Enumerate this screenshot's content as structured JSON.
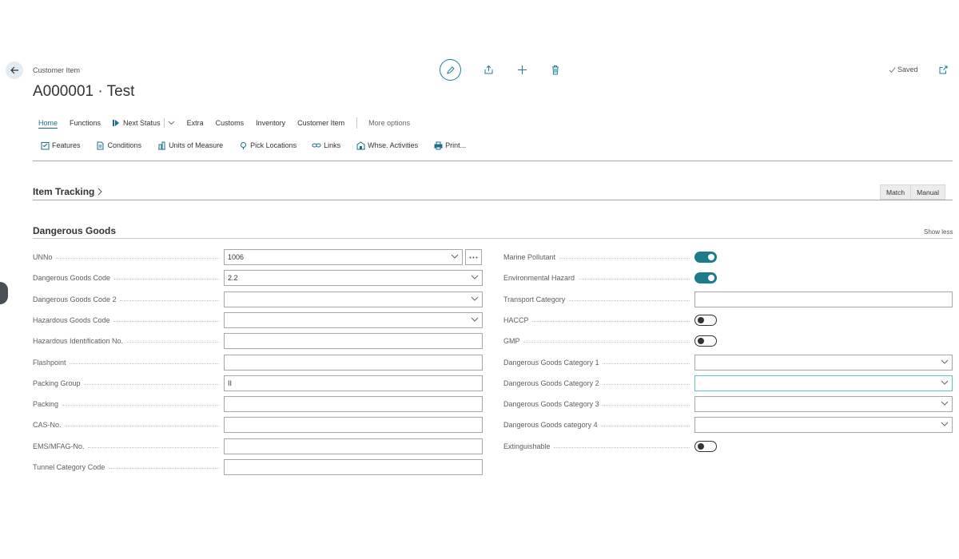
{
  "header": {
    "breadcrumb": "Customer Item",
    "title": "A000001 · Test",
    "saved_label": "Saved"
  },
  "tabs": [
    {
      "label": "Home",
      "active": true
    },
    {
      "label": "Functions"
    },
    {
      "label": "Next Status"
    },
    {
      "label": "Extra"
    },
    {
      "label": "Customs"
    },
    {
      "label": "Inventory"
    },
    {
      "label": "Customer Item"
    }
  ],
  "more_options": "More options",
  "promoted": [
    {
      "label": "Features",
      "icon": "features-icon"
    },
    {
      "label": "Conditions",
      "icon": "conditions-icon"
    },
    {
      "label": "Units of Measure",
      "icon": "units-icon"
    },
    {
      "label": "Pick Locations",
      "icon": "pick-locations-icon"
    },
    {
      "label": "Links",
      "icon": "links-icon"
    },
    {
      "label": "Whse. Activities",
      "icon": "whse-activities-icon"
    },
    {
      "label": "Print...",
      "icon": "print-icon"
    }
  ],
  "item_tracking": {
    "title": "Item Tracking",
    "match": "Match",
    "manual": "Manual"
  },
  "dangerous_goods": {
    "title": "Dangerous Goods",
    "show_less": "Show less",
    "left": [
      {
        "label": "UNNo",
        "value": "1006",
        "type": "select",
        "assist": true
      },
      {
        "label": "Dangerous Goods Code",
        "value": "2.2",
        "type": "select"
      },
      {
        "label": "Dangerous Goods Code 2",
        "value": "",
        "type": "select"
      },
      {
        "label": "Hazardous Goods Code",
        "value": "",
        "type": "select"
      },
      {
        "label": "Hazardous Identification No.",
        "value": "",
        "type": "text"
      },
      {
        "label": "Flashpoint",
        "value": "",
        "type": "text"
      },
      {
        "label": "Packing Group",
        "value": "II",
        "type": "text"
      },
      {
        "label": "Packing",
        "value": "",
        "type": "text"
      },
      {
        "label": "CAS-No.",
        "value": "",
        "type": "text"
      },
      {
        "label": "EMS/MFAG-No.",
        "value": "",
        "type": "text"
      },
      {
        "label": "Tunnel Category Code",
        "value": "",
        "type": "text"
      }
    ],
    "right": [
      {
        "label": "Marine Pollutant",
        "type": "toggle",
        "on": true
      },
      {
        "label": "Environmental Hazard",
        "type": "toggle",
        "on": true
      },
      {
        "label": "Transport Category",
        "type": "text",
        "value": ""
      },
      {
        "label": "HACCP",
        "type": "toggle",
        "on": false
      },
      {
        "label": "GMP",
        "type": "toggle",
        "on": false
      },
      {
        "label": "Dangerous Goods Category 1",
        "type": "select",
        "value": ""
      },
      {
        "label": "Dangerous Goods Category 2",
        "type": "select",
        "value": "",
        "focused": true
      },
      {
        "label": "Dangerous Goods Category 3",
        "type": "select",
        "value": ""
      },
      {
        "label": "Dangerous Goods category 4",
        "type": "select",
        "value": ""
      },
      {
        "label": "Extinguishable",
        "type": "toggle",
        "on": false
      }
    ]
  },
  "colors": {
    "accent": "#1c7c8c",
    "link": "#1e6d8a"
  }
}
